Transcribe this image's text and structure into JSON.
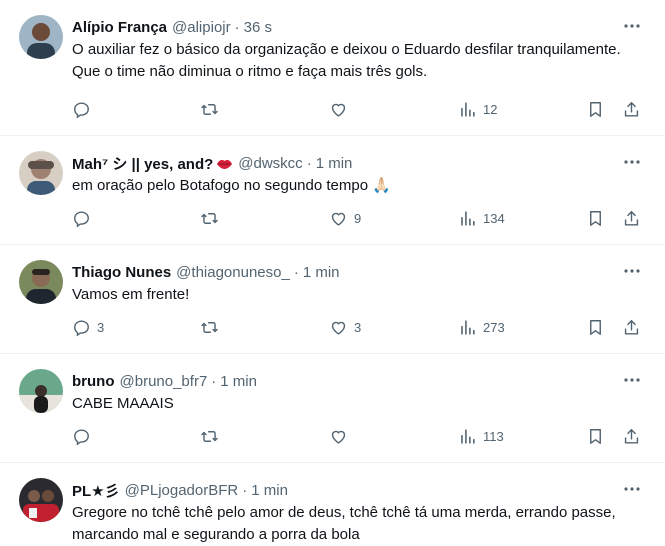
{
  "tweets": [
    {
      "name": "Alípio França",
      "handle": "@alipiojr",
      "time": "36 s",
      "text": "O auxiliar fez o básico da organização e deixou o Eduardo desfilar tranquilamente. Que o time não diminua o ritmo e faça mais três gols.",
      "replies": "",
      "retweets": "",
      "likes": "",
      "views": "12",
      "avatar_color": "#3a4d5c"
    },
    {
      "name": "Mah⁷ シ || yes, and?",
      "handle": "@dwskcc",
      "time": "1 min",
      "text": "em oração pelo Botafogo no segundo tempo 🙏🏻",
      "replies": "",
      "retweets": "",
      "likes": "9",
      "views": "134",
      "avatar_color": "#b8a08a"
    },
    {
      "name": "Thiago Nunes",
      "handle": "@thiagonuneso_",
      "time": "1 min",
      "text": "Vamos em frente!",
      "replies": "3",
      "retweets": "",
      "likes": "3",
      "views": "273",
      "avatar_color": "#4a5a3c"
    },
    {
      "name": "bruno",
      "handle": "@bruno_bfr7",
      "time": "1 min",
      "text": "CABE MAAAIS",
      "replies": "",
      "retweets": "",
      "likes": "",
      "views": "113",
      "avatar_color": "#5b8a7a"
    },
    {
      "name": "PL★彡",
      "handle": "@PLjogadorBFR",
      "time": "1 min",
      "text": "Gregore no tchê tchê pelo amor de deus, tchê tchê tá uma merda, errando passe, marcando mal e segurando a porra da bola",
      "replies": "",
      "retweets": "",
      "likes": "",
      "views": "",
      "avatar_color": "#3c3c44"
    }
  ],
  "colors": {
    "text": "#0f1419",
    "secondary": "#536471",
    "divider": "#eff3f4"
  }
}
